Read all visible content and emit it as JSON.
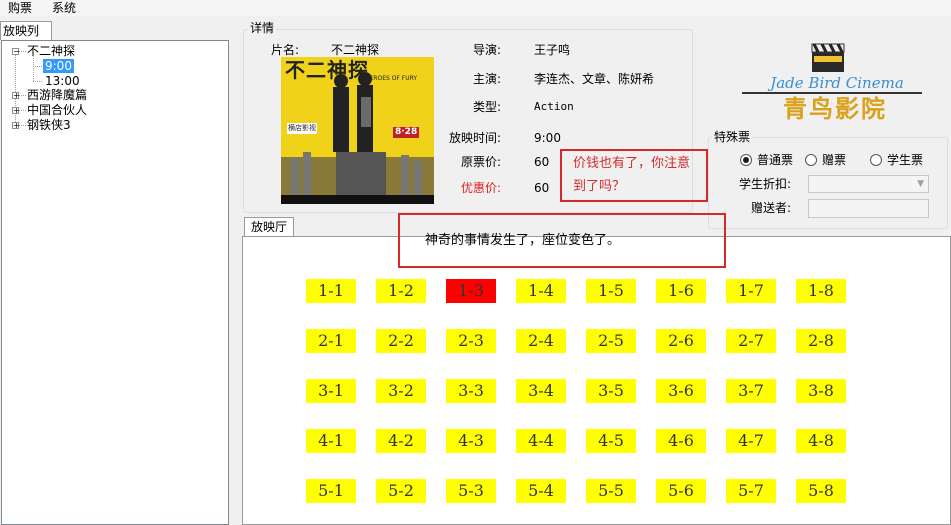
{
  "menu": {
    "items": [
      "购票",
      "系统"
    ]
  },
  "left_tab": {
    "label": "放映列表"
  },
  "tree": {
    "movies": [
      {
        "title": "不二神探",
        "expanded": true,
        "times": [
          "9:00",
          "13:00"
        ],
        "selected_time": "9:00"
      },
      {
        "title": "西游降魔篇",
        "expanded": false
      },
      {
        "title": "中国合伙人",
        "expanded": false
      },
      {
        "title": "钢铁侠3",
        "expanded": false
      }
    ]
  },
  "details": {
    "legend": "详情",
    "movie_name_label": "片名:",
    "movie_name": "不二神探",
    "director_label": "导演:",
    "director": "王子鸣",
    "actors_label": "主演:",
    "actors": "李连杰、文章、陈妍希",
    "type_label": "类型:",
    "type": "Action",
    "showtime_label": "放映时间:",
    "showtime": "9:00",
    "original_price_label": "原票价:",
    "original_price": "60",
    "discount_price_label": "优惠价:",
    "discount_price": "60",
    "poster": {
      "title_text": "不二神探",
      "subtitle_text": "HEROES OF FURY",
      "badge_text": "8·28",
      "side_text": "横店影视"
    }
  },
  "logo": {
    "english": "Jade Bird Cinema",
    "chinese": "青鸟影院"
  },
  "special_ticket": {
    "legend": "特殊票",
    "options": [
      "普通票",
      "赠票",
      "学生票"
    ],
    "selected": "普通票",
    "student_discount_label": "学生折扣:",
    "student_discount_value": "",
    "gift_giver_label": "赠送者:",
    "gift_giver_value": ""
  },
  "annotations": {
    "price_note": "价钱也有了，你注意到了吗？",
    "price_note_line1": "价钱也有了，你注意",
    "price_note_line2": "到了吗？",
    "seat_note": "神奇的事情发生了，座位变色了。"
  },
  "hall": {
    "tab_label": "放映厅",
    "rows": [
      [
        "1-1",
        "1-2",
        "1-3",
        "1-4",
        "1-5",
        "1-6",
        "1-7",
        "1-8"
      ],
      [
        "2-1",
        "2-2",
        "2-3",
        "2-4",
        "2-5",
        "2-6",
        "2-7",
        "2-8"
      ],
      [
        "3-1",
        "3-2",
        "3-3",
        "3-4",
        "3-5",
        "3-6",
        "3-7",
        "3-8"
      ],
      [
        "4-1",
        "4-2",
        "4-3",
        "4-4",
        "4-5",
        "4-6",
        "4-7",
        "4-8"
      ],
      [
        "5-1",
        "5-2",
        "5-3",
        "5-4",
        "5-5",
        "5-6",
        "5-7",
        "5-8"
      ]
    ],
    "sold_seats": [
      "1-3"
    ],
    "colors": {
      "available": "#ffff00",
      "sold": "#ff0000"
    }
  },
  "colors": {
    "accent_red": "#d42a2a",
    "tree_selected": "#3399ff"
  }
}
